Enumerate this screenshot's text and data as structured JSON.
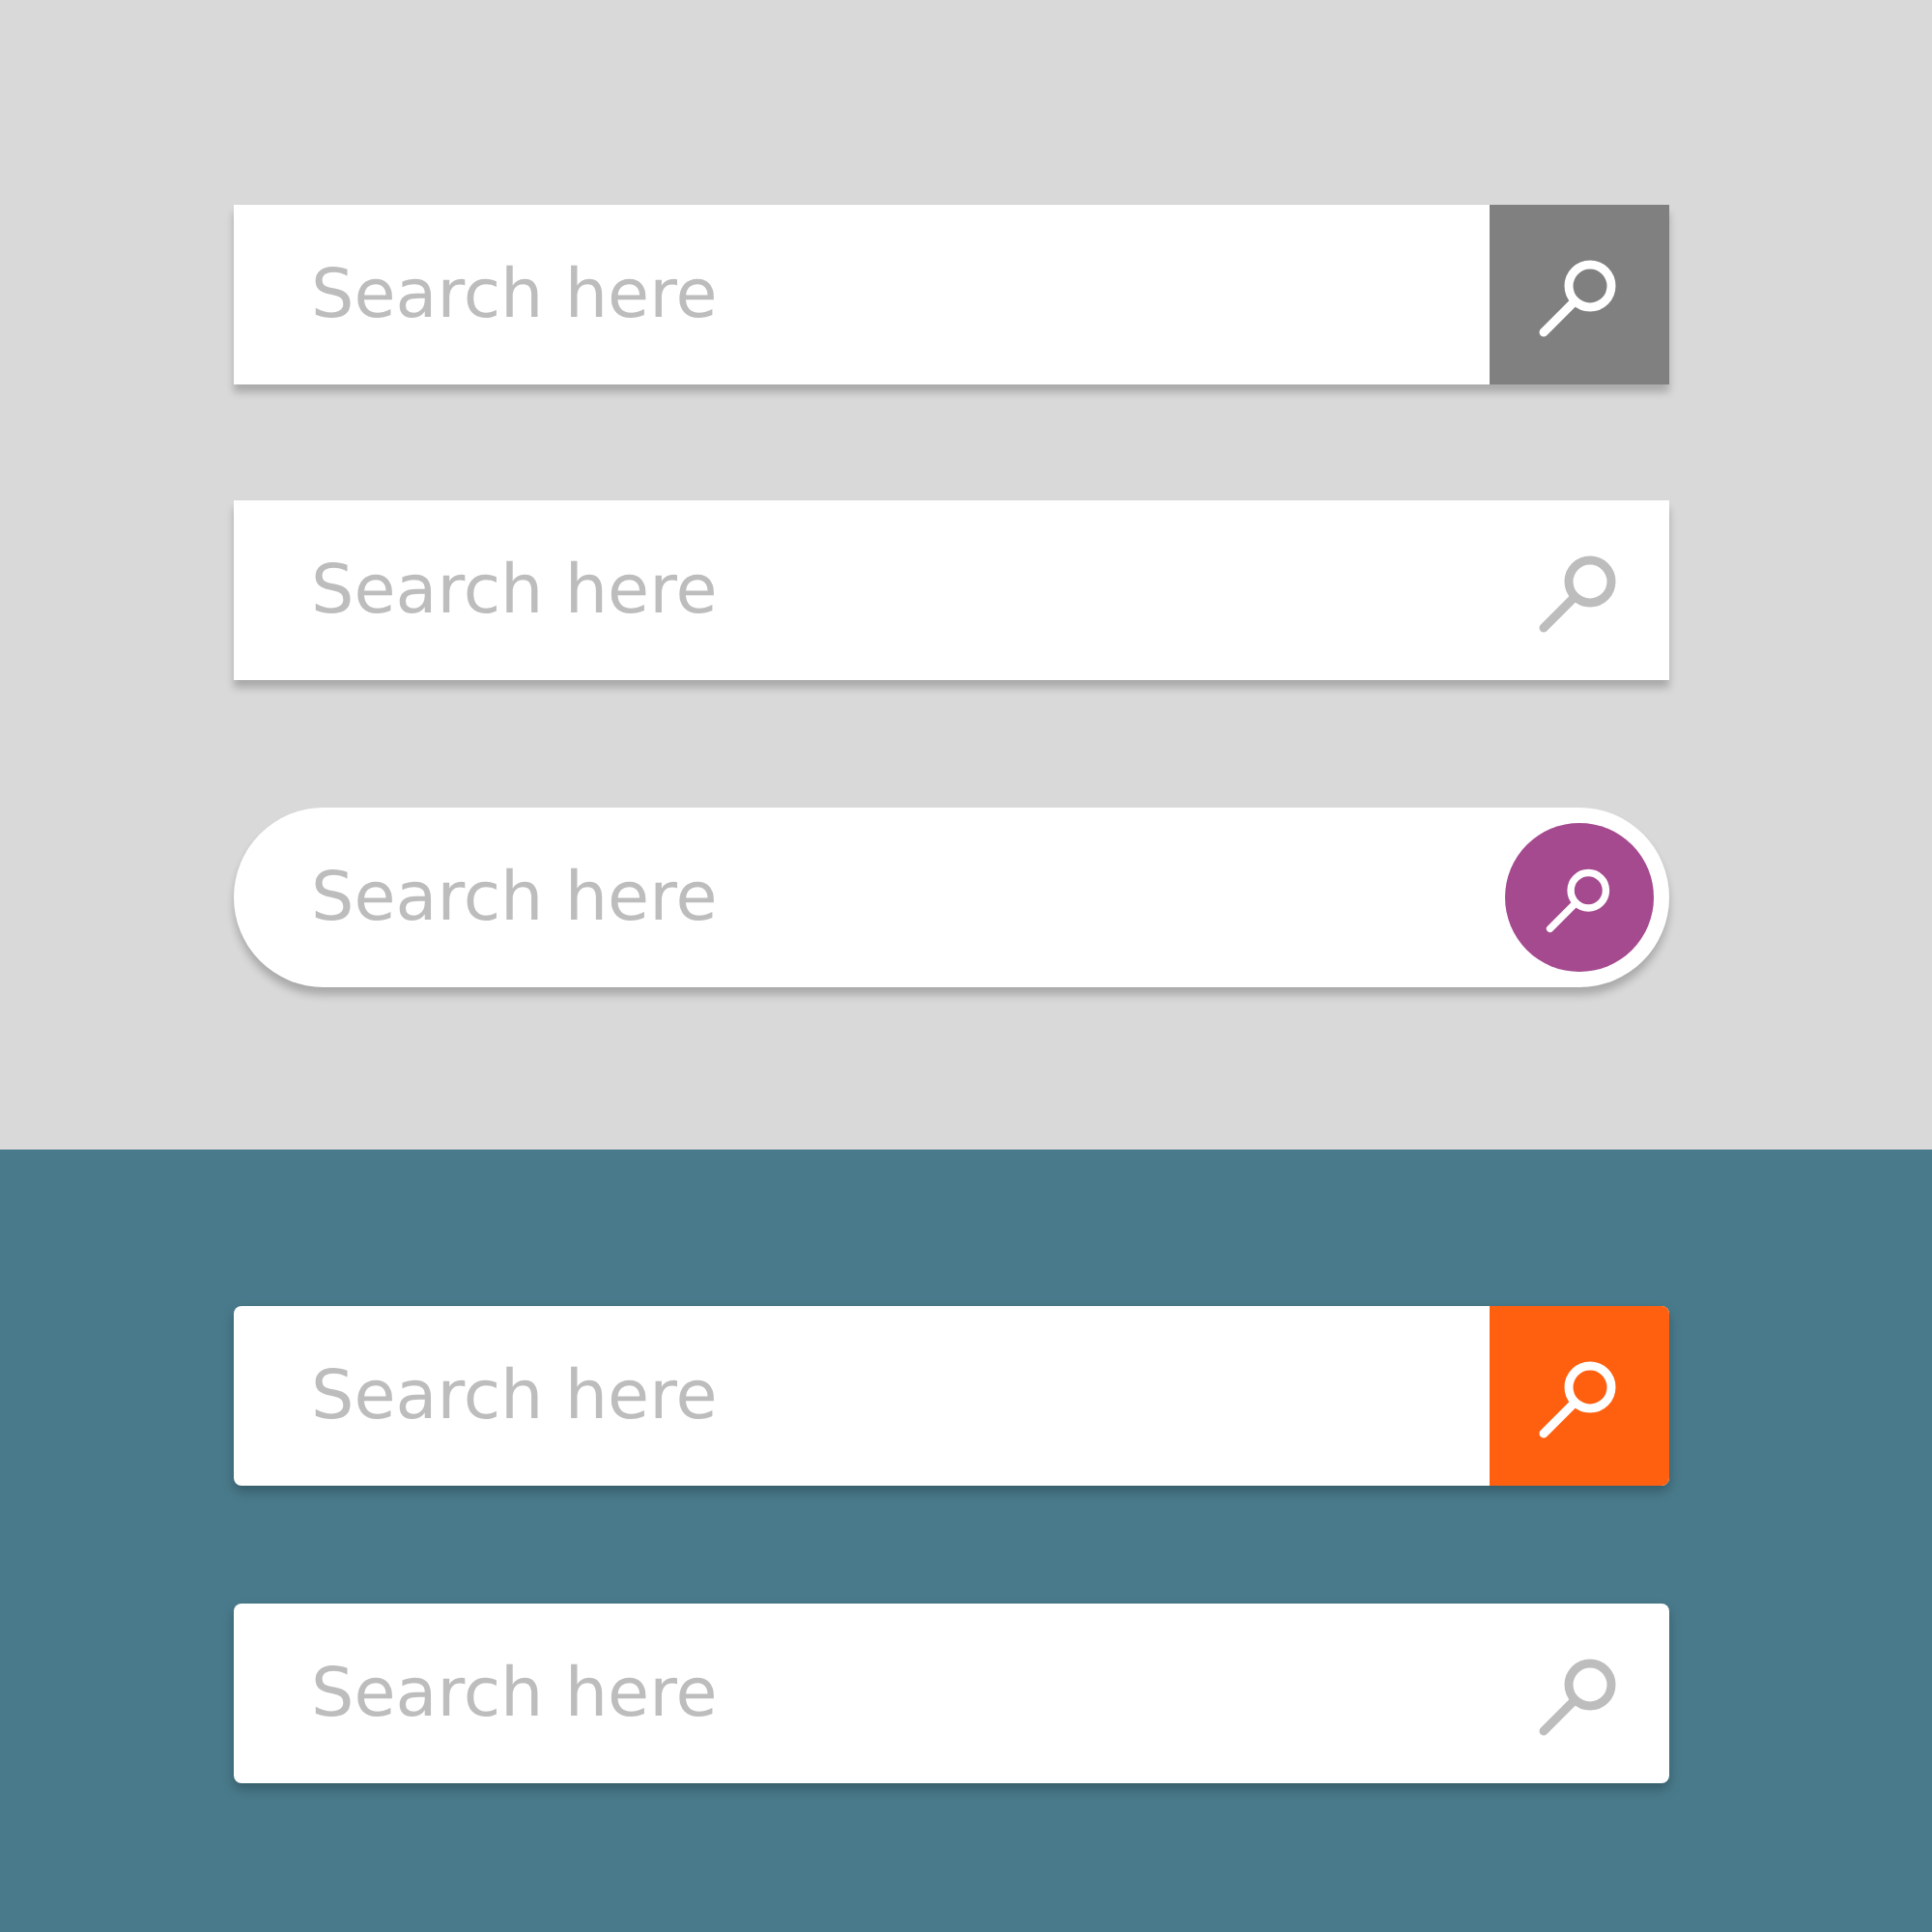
{
  "sections": [
    {
      "bars": [
        {
          "kind": "button",
          "placeholder": "Search here",
          "color": "#808080"
        },
        {
          "kind": "icon",
          "placeholder": "Search here"
        },
        {
          "kind": "pill",
          "placeholder": "Search here",
          "color": "#a54a8f"
        }
      ]
    },
    {
      "bars": [
        {
          "kind": "button",
          "placeholder": "Search here",
          "color": "#ff6010"
        },
        {
          "kind": "icon",
          "placeholder": "Search here"
        }
      ]
    }
  ]
}
